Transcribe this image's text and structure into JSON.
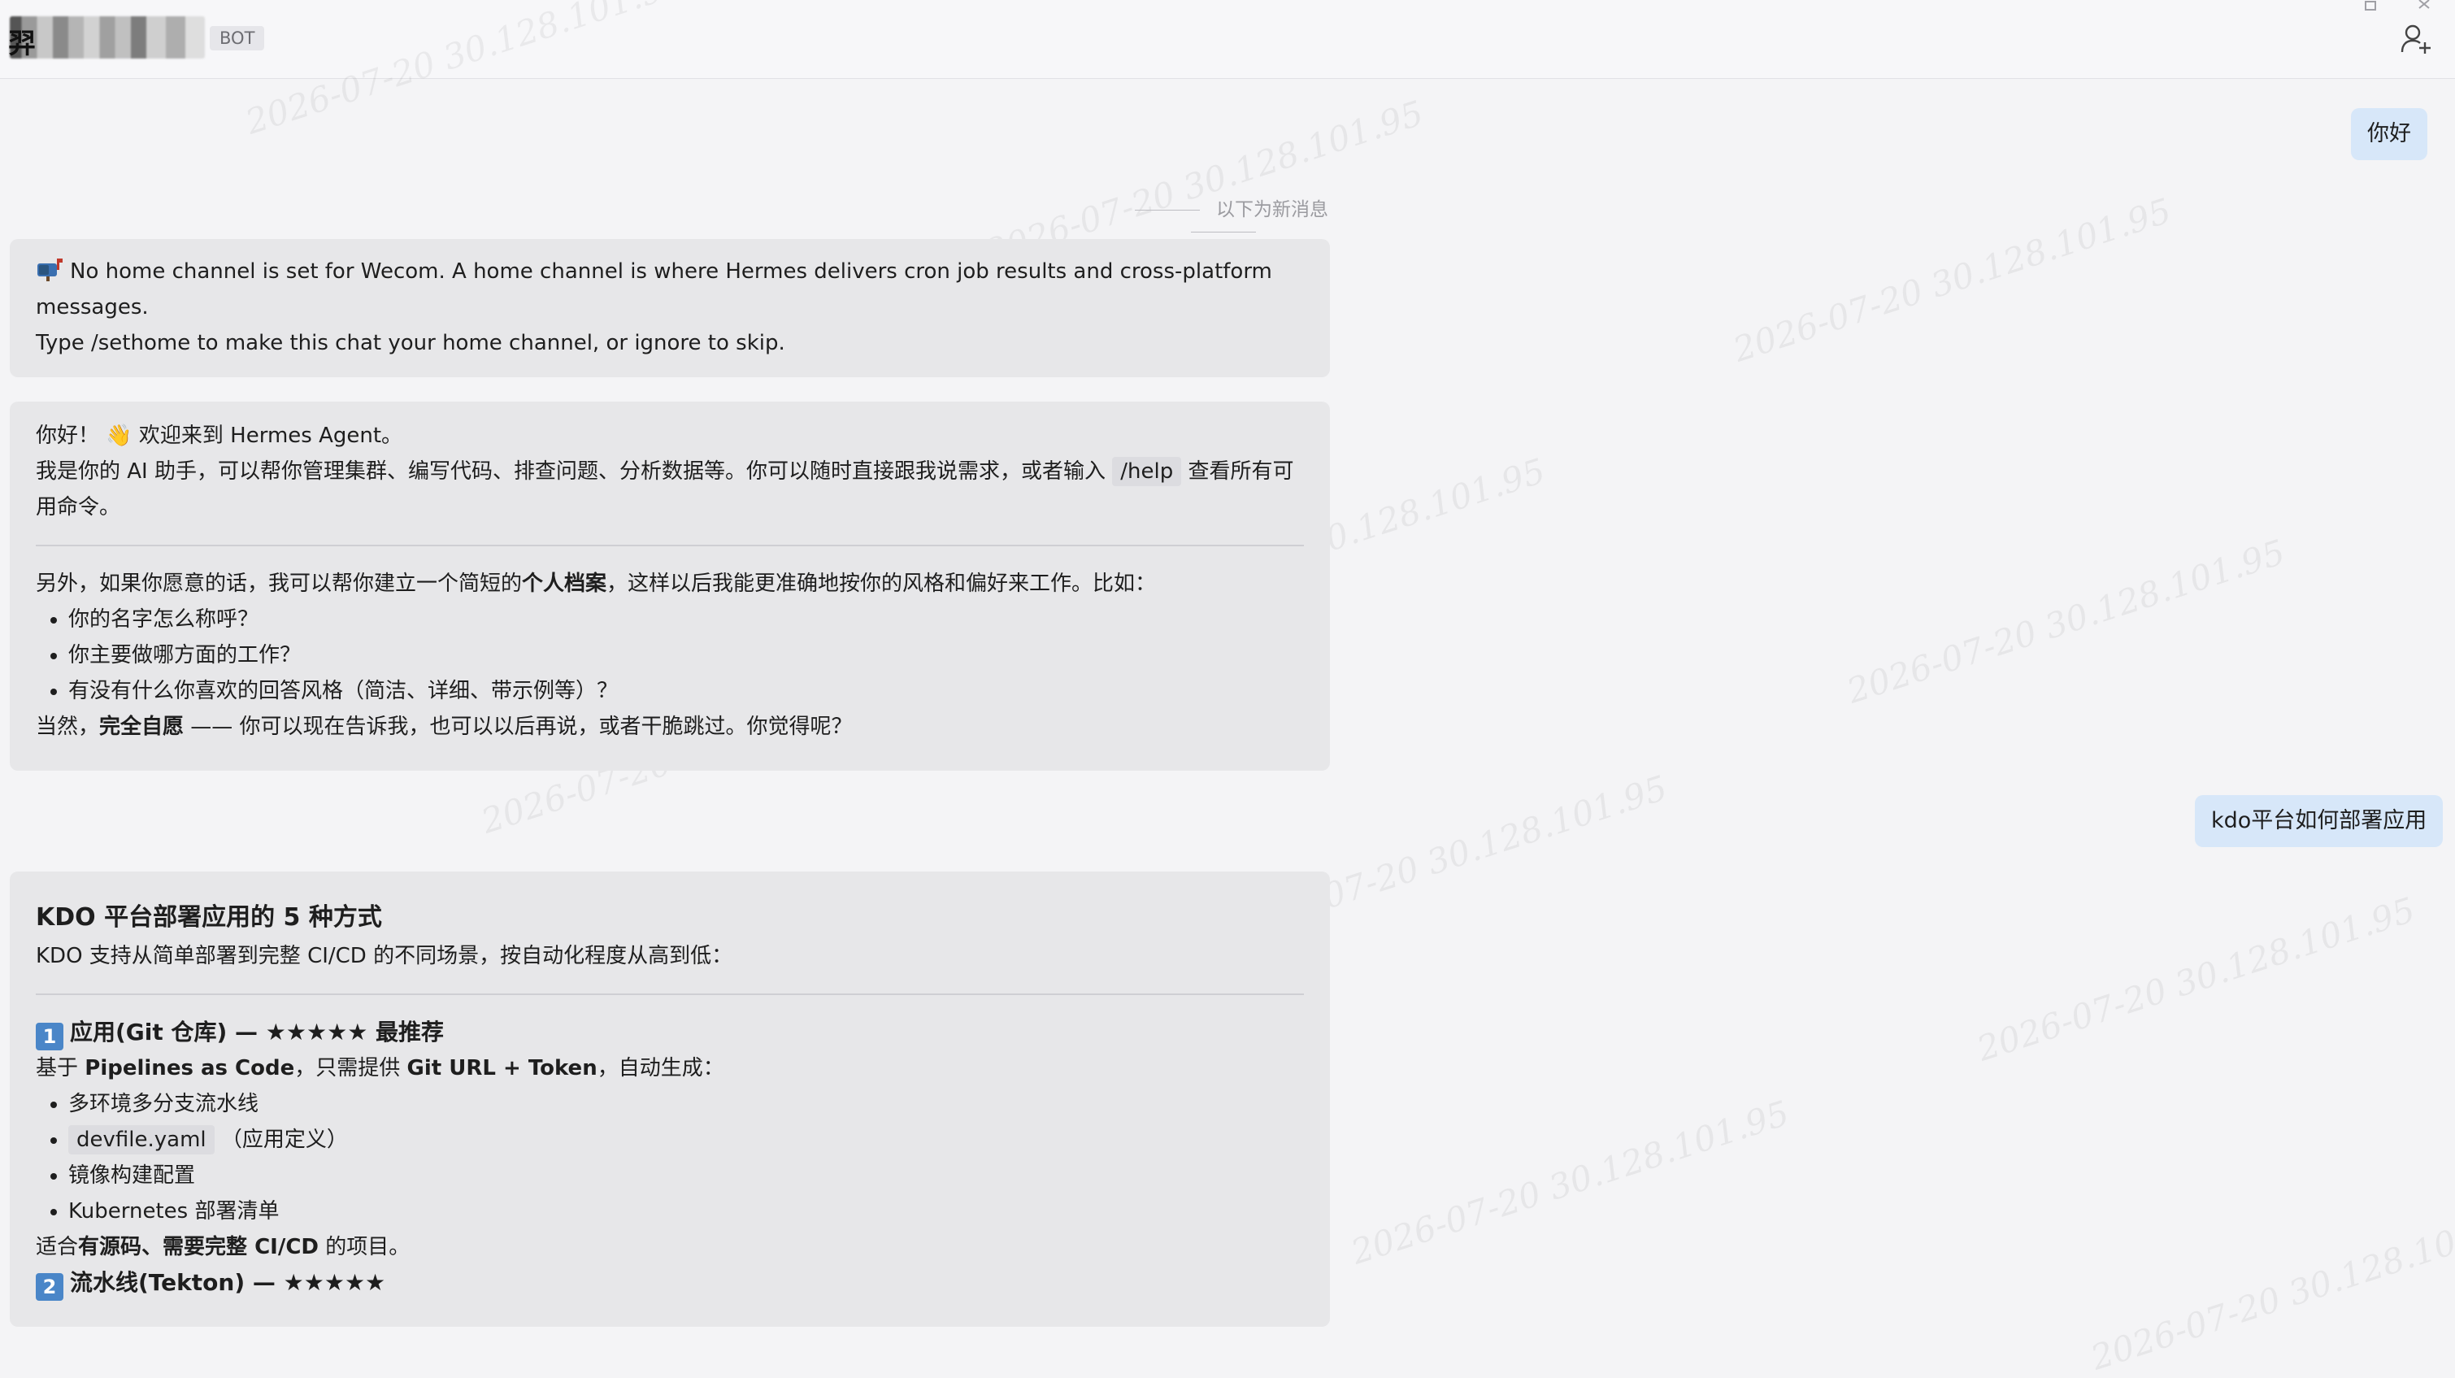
{
  "header": {
    "title": "羿",
    "badge": "BOT",
    "icons": [
      "restore-icon",
      "close-icon",
      "add-user-icon"
    ]
  },
  "watermark": "2026-07-20 30.128.101.95",
  "messages": {
    "user_greeting": "你好",
    "new_divider": "以下为新消息",
    "notice": {
      "line1": "No home channel is set for Wecom. A home channel is where Hermes delivers cron job results and cross-platform messages.",
      "line2": "Type /sethome to make this chat your home channel, or ignore to skip."
    },
    "welcome": {
      "line1_a": "你好！",
      "line1_emoji": "👋",
      "line1_b": "欢迎来到 Hermes Agent。",
      "line2_a": "我是你的 AI 助手，可以帮你管理集群、编写代码、排查问题、分析数据等。你可以随时直接跟我说需求，或者输入",
      "help_cmd": "/help",
      "line2_b": "查看所有可用命令。",
      "profile_a": "另外，如果你愿意的话，我可以帮你建立一个简短的",
      "profile_bold": "个人档案",
      "profile_b": "，这样以后我能更准确地按你的风格和偏好来工作。比如：",
      "questions": [
        "你的名字怎么称呼？",
        "你主要做哪方面的工作？",
        "有没有什么你喜欢的回答风格（简洁、详细、带示例等）？"
      ],
      "closing_a": "当然，",
      "closing_bold": "完全自愿",
      "closing_b": " —— 你可以现在告诉我，也可以以后再说，或者干脆跳过。你觉得呢？"
    },
    "user_question": "kdo平台如何部署应用",
    "answer": {
      "title": "KDO 平台部署应用的 5 种方式",
      "intro": "KDO 支持从简单部署到完整 CI/CD 的不同场景，按自动化程度从高到低：",
      "s1_num": "1",
      "s1_title": "应用(Git 仓库) — ★★★★★ 最推荐",
      "s1_desc_a": "基于 ",
      "s1_desc_b1": "Pipelines as Code",
      "s1_desc_c": "，只需提供 ",
      "s1_desc_b2": "Git URL + Token",
      "s1_desc_d": "，自动生成：",
      "s1_item1": "多环境多分支流水线",
      "s1_item2_code": "devfile.yaml",
      "s1_item2_text": "（应用定义）",
      "s1_item3": "镜像构建配置",
      "s1_item4": "Kubernetes 部署清单",
      "s1_fit_a": "适合",
      "s1_fit_bold": "有源码、需要完整 CI/CD",
      "s1_fit_b": " 的项目。",
      "s2_num": "2",
      "s2_title": "流水线(Tekton) — ★★★★★"
    }
  }
}
